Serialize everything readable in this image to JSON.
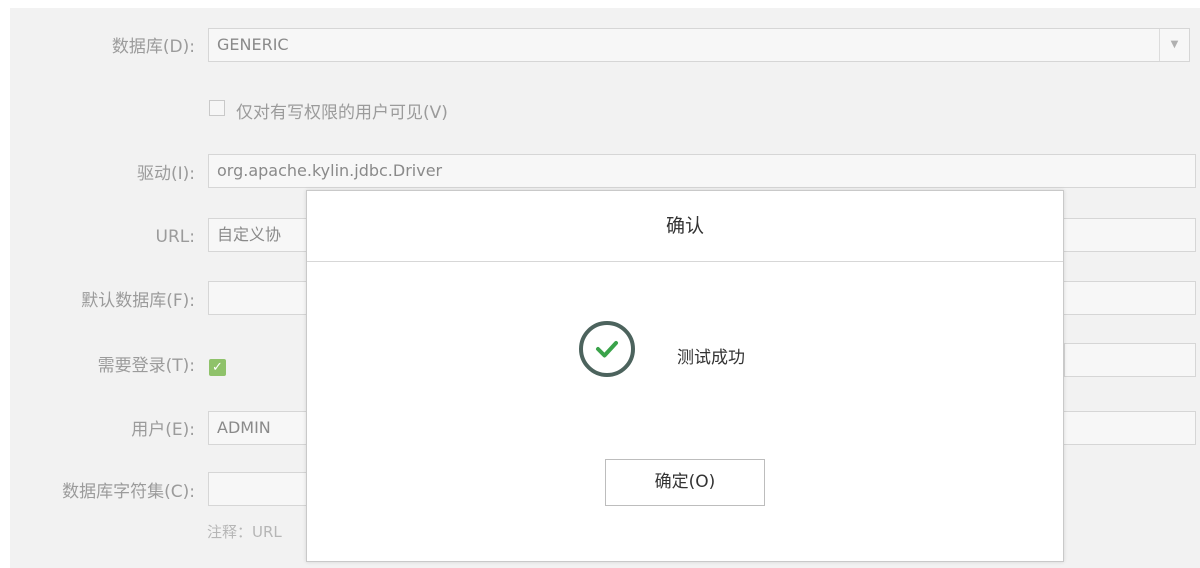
{
  "form": {
    "database": {
      "label": "数据库(D):",
      "value": "GENERIC"
    },
    "visible_checkbox": {
      "label": "仅对有写权限的用户可见(V)",
      "checked": false
    },
    "driver": {
      "label": "驱动(I):",
      "value": "org.apache.kylin.jdbc.Driver"
    },
    "url": {
      "label": "URL:",
      "value": "自定义协"
    },
    "default_db": {
      "label": "默认数据库(F):",
      "value": ""
    },
    "login_required": {
      "label": "需要登录(T):",
      "checked": true
    },
    "user": {
      "label": "用户(E):",
      "value": "ADMIN"
    },
    "charset": {
      "label": "数据库字符集(C):",
      "value": ""
    },
    "note": "注释：URL"
  },
  "dialog": {
    "title": "确认",
    "message": "测试成功",
    "icon": "success-check-icon",
    "ok_label": "确定(O)"
  },
  "colors": {
    "success_green": "#3aa34a",
    "icon_ring": "#4c635d",
    "checkbox_green": "#8fc26a"
  }
}
